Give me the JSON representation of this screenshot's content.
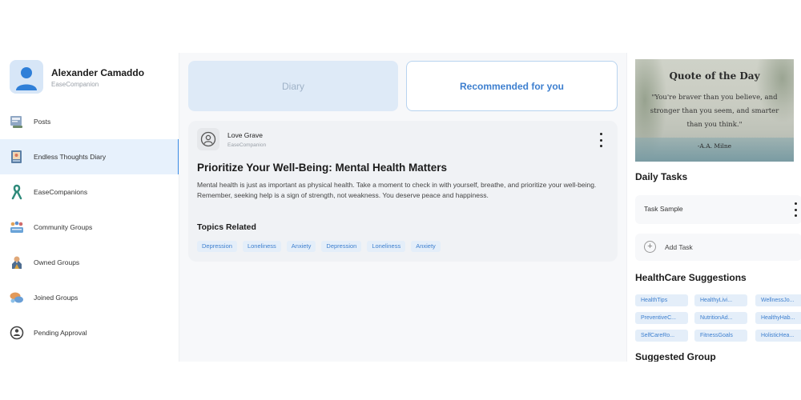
{
  "profile": {
    "name": "Alexander Camaddo",
    "subtitle": "EaseCompanion"
  },
  "sidebar": {
    "items": [
      {
        "label": "Posts",
        "icon": "posts-icon",
        "active": false
      },
      {
        "label": "Endless Thoughts Diary",
        "icon": "diary-icon",
        "active": true
      },
      {
        "label": "EaseCompanions",
        "icon": "ribbon-icon",
        "active": false
      },
      {
        "label": "Community Groups",
        "icon": "community-icon",
        "active": false
      },
      {
        "label": "Owned Groups",
        "icon": "owner-icon",
        "active": false
      },
      {
        "label": "Joined Groups",
        "icon": "chat-bubbles-icon",
        "active": false
      },
      {
        "label": "Pending Approval",
        "icon": "pending-icon",
        "active": false
      }
    ]
  },
  "tabs": {
    "diary": "Diary",
    "recommended": "Recommended for you",
    "selected": "recommended"
  },
  "post": {
    "author": "Love Grave",
    "author_subtitle": "EaseCompanion",
    "title": "Prioritize Your Well-Being: Mental Health Matters",
    "body": "Mental health is just as important as physical health. Take a moment to check in with yourself, breathe, and prioritize your well-being. Remember, seeking help is a sign of strength, not weakness. You deserve peace and happiness.",
    "topics_label": "Topics Related",
    "topics": [
      "Depression",
      "Loneliness",
      "Anxiety",
      "Depression",
      "Loneliness",
      "Anxiety"
    ]
  },
  "quote": {
    "title": "Quote of the Day",
    "text": "\"You're braver than you believe, and stronger than you seem, and smarter than you think.\"",
    "author": "-A.A. Milne"
  },
  "daily_tasks": {
    "title": "Daily Tasks",
    "items": [
      "Task Sample"
    ],
    "add_label": "Add Task"
  },
  "healthcare": {
    "title": "HealthCare Suggestions",
    "chips": [
      "HealthTips",
      "HealthyLivi...",
      "WellnessJo...",
      "PreventiveC...",
      "NutritionAd...",
      "HealthyHab...",
      "SelfCareRo...",
      "FitnessGoals",
      "HolisticHea..."
    ]
  },
  "suggested_group": {
    "title": "Suggested Group"
  },
  "colors": {
    "accent": "#3d8ee8",
    "chip_bg": "#e4eef9",
    "chip_text": "#3d7fcf",
    "active_nav_bg": "#e7f1fc"
  }
}
